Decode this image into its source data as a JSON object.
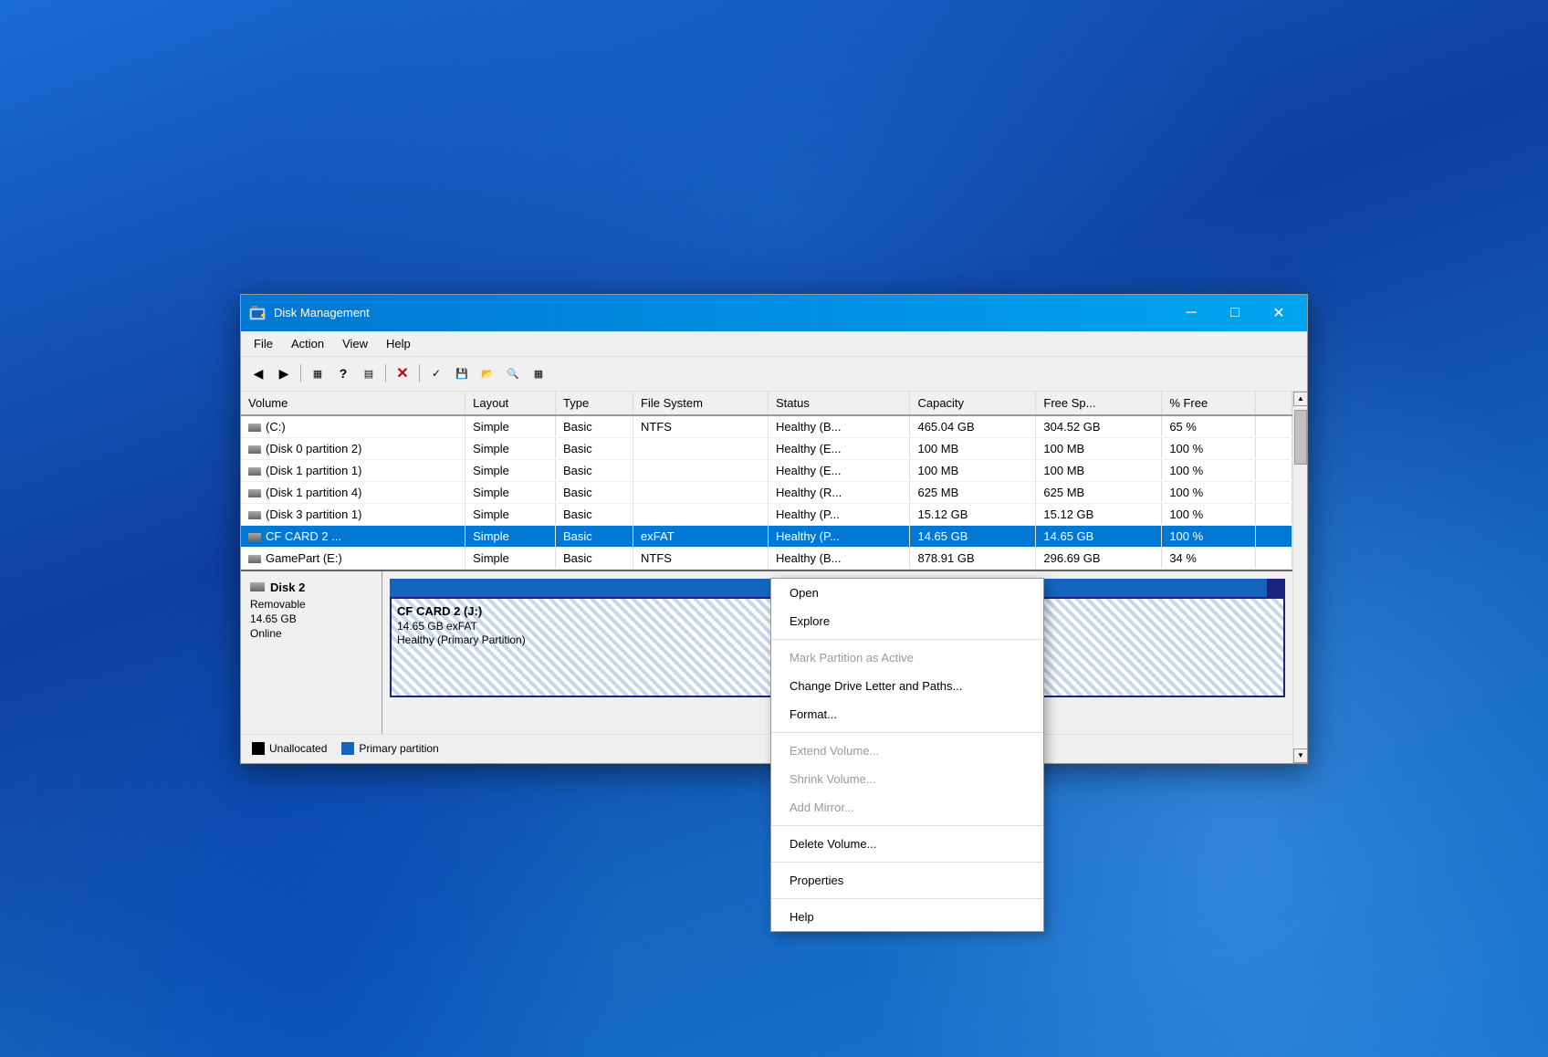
{
  "window": {
    "title": "Disk Management",
    "icon": "💾"
  },
  "titlebar": {
    "minimize_label": "─",
    "maximize_label": "□",
    "close_label": "✕"
  },
  "menu": {
    "items": [
      "File",
      "Action",
      "View",
      "Help"
    ]
  },
  "toolbar": {
    "buttons": [
      {
        "name": "back-btn",
        "icon": "◀",
        "disabled": false
      },
      {
        "name": "forward-btn",
        "icon": "▶",
        "disabled": false
      },
      {
        "name": "disk-view-btn",
        "icon": "▦",
        "disabled": false
      },
      {
        "name": "help-btn",
        "icon": "?",
        "disabled": false
      },
      {
        "name": "partition-btn",
        "icon": "▤",
        "disabled": false
      },
      {
        "name": "delete-btn",
        "icon": "✕",
        "disabled": false,
        "red": true
      },
      {
        "name": "check-btn",
        "icon": "✓",
        "disabled": false
      },
      {
        "name": "save-btn",
        "icon": "💾",
        "disabled": false
      },
      {
        "name": "folder-btn",
        "icon": "📁",
        "disabled": false
      },
      {
        "name": "search-btn",
        "icon": "🔍",
        "disabled": false
      },
      {
        "name": "app-btn",
        "icon": "▦",
        "disabled": false
      }
    ]
  },
  "table": {
    "columns": [
      "Volume",
      "Layout",
      "Type",
      "File System",
      "Status",
      "Capacity",
      "Free Sp...",
      "% Free"
    ],
    "rows": [
      {
        "volume": "(C:)",
        "layout": "Simple",
        "type": "Basic",
        "fs": "NTFS",
        "status": "Healthy (B...",
        "capacity": "465.04 GB",
        "free": "304.52 GB",
        "pct": "65 %"
      },
      {
        "volume": "(Disk 0 partition 2)",
        "layout": "Simple",
        "type": "Basic",
        "fs": "",
        "status": "Healthy (E...",
        "capacity": "100 MB",
        "free": "100 MB",
        "pct": "100 %"
      },
      {
        "volume": "(Disk 1 partition 1)",
        "layout": "Simple",
        "type": "Basic",
        "fs": "",
        "status": "Healthy (E...",
        "capacity": "100 MB",
        "free": "100 MB",
        "pct": "100 %"
      },
      {
        "volume": "(Disk 1 partition 4)",
        "layout": "Simple",
        "type": "Basic",
        "fs": "",
        "status": "Healthy (R...",
        "capacity": "625 MB",
        "free": "625 MB",
        "pct": "100 %"
      },
      {
        "volume": "(Disk 3 partition 1)",
        "layout": "Simple",
        "type": "Basic",
        "fs": "",
        "status": "Healthy (P...",
        "capacity": "15.12 GB",
        "free": "15.12 GB",
        "pct": "100 %"
      },
      {
        "volume": "CF CARD 2 ...",
        "layout": "Simple",
        "type": "Basic",
        "fs": "exFAT",
        "status": "Healthy (P...",
        "capacity": "14.65 GB",
        "free": "14.65 GB",
        "pct": "100 %"
      },
      {
        "volume": "GamePart (E:)",
        "layout": "Simple",
        "type": "Basic",
        "fs": "NTFS",
        "status": "Healthy (B...",
        "capacity": "878.91 GB",
        "free": "296.69 GB",
        "pct": "34 %"
      }
    ]
  },
  "lower_disk": {
    "name": "Disk 2",
    "type": "Removable",
    "size": "14.65 GB",
    "status": "Online",
    "partition_title": "CF CARD 2  (J:)",
    "partition_size": "14.65 GB exFAT",
    "partition_status": "Healthy (Primary Partition)"
  },
  "legend": {
    "unallocated_label": "Unallocated",
    "primary_label": "Primary partition"
  },
  "context_menu": {
    "items": [
      {
        "label": "Open",
        "disabled": false,
        "separator_after": false
      },
      {
        "label": "Explore",
        "disabled": false,
        "separator_after": true
      },
      {
        "label": "Mark Partition as Active",
        "disabled": true,
        "separator_after": false
      },
      {
        "label": "Change Drive Letter and Paths...",
        "disabled": false,
        "separator_after": false
      },
      {
        "label": "Format...",
        "disabled": false,
        "separator_after": true
      },
      {
        "label": "Extend Volume...",
        "disabled": true,
        "separator_after": false
      },
      {
        "label": "Shrink Volume...",
        "disabled": true,
        "separator_after": false
      },
      {
        "label": "Add Mirror...",
        "disabled": true,
        "separator_after": true
      },
      {
        "label": "Delete Volume...",
        "disabled": false,
        "separator_after": true
      },
      {
        "label": "Properties",
        "disabled": false,
        "separator_after": true
      },
      {
        "label": "Help",
        "disabled": false,
        "separator_after": false
      }
    ]
  }
}
